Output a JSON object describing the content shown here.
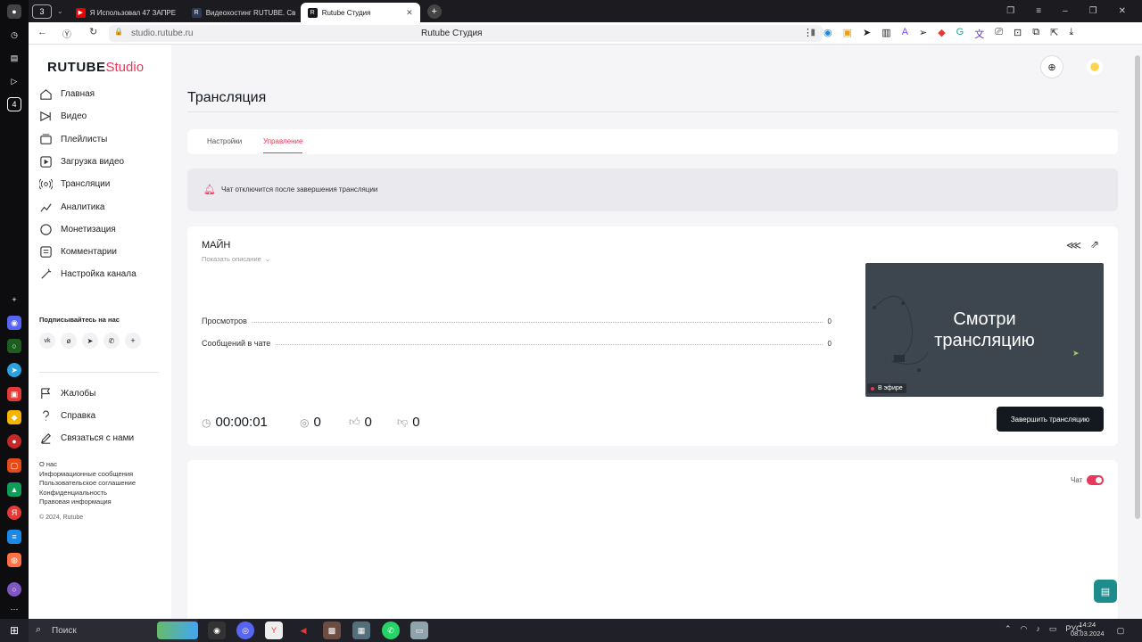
{
  "browser": {
    "tab_count": "3",
    "tabs": [
      {
        "label": "Я Использовал 47 ЗАПРЕ"
      },
      {
        "label": "Видеохостинг RUTUBE. Св"
      },
      {
        "label": "Rutube Студия"
      }
    ],
    "url": "studio.rutube.ru",
    "page_title": "Rutube Студия"
  },
  "brand": {
    "logo_text": "RUTUBE",
    "logo_suffix": "Studio",
    "accent": "#e8375a"
  },
  "sidebar": {
    "items": [
      {
        "label": "Главная",
        "icon": "home-icon"
      },
      {
        "label": "Видео",
        "icon": "video-icon"
      },
      {
        "label": "Плейлисты",
        "icon": "playlist-icon"
      },
      {
        "label": "Загрузка видео",
        "icon": "upload-icon"
      },
      {
        "label": "Трансляции",
        "icon": "broadcast-icon"
      },
      {
        "label": "Аналитика",
        "icon": "analytics-icon"
      },
      {
        "label": "Монетизация",
        "icon": "coin-icon"
      },
      {
        "label": "Комментарии",
        "icon": "comment-icon"
      },
      {
        "label": "Настройка канала",
        "icon": "wand-icon"
      }
    ],
    "subscribe_title": "Подписывайтесь на нас",
    "socials": [
      "vk-icon",
      "ok-icon",
      "telegram-icon",
      "viber-icon",
      "more-icon"
    ],
    "support": [
      {
        "label": "Жалобы",
        "icon": "flag-icon"
      },
      {
        "label": "Справка",
        "icon": "help-icon"
      },
      {
        "label": "Связаться с нами",
        "icon": "edit-icon"
      }
    ],
    "footer_links": [
      "О нас",
      "Информационные сообщения",
      "Пользовательское соглашение",
      "Конфиденциальность",
      "Правовая информация"
    ],
    "copyright": "© 2024, Rutube"
  },
  "main": {
    "title": "Трансляция",
    "tabs": [
      {
        "label": "Настройки",
        "active": false
      },
      {
        "label": "Управление",
        "active": true
      }
    ],
    "notice": "Чат отключится после завершения трансляции",
    "stream": {
      "name": "МАЙН",
      "show_description": "Показать описание",
      "stats": [
        {
          "label": "Просмотров",
          "value": "0"
        },
        {
          "label": "Сообщений в чате",
          "value": "0"
        }
      ],
      "duration": "00:00:01",
      "viewers": "0",
      "likes": "0",
      "dislikes": "0",
      "preview_text_line1": "Смотри",
      "preview_text_line2": "трансляцию",
      "live_badge": "В эфире",
      "end_button": "Завершить трансляцию"
    },
    "chat_label": "Чат",
    "chat_enabled": true
  },
  "taskbar": {
    "search_placeholder": "Поиск",
    "lang": "РУС",
    "time": "14:24",
    "date": "08.03.2024"
  }
}
